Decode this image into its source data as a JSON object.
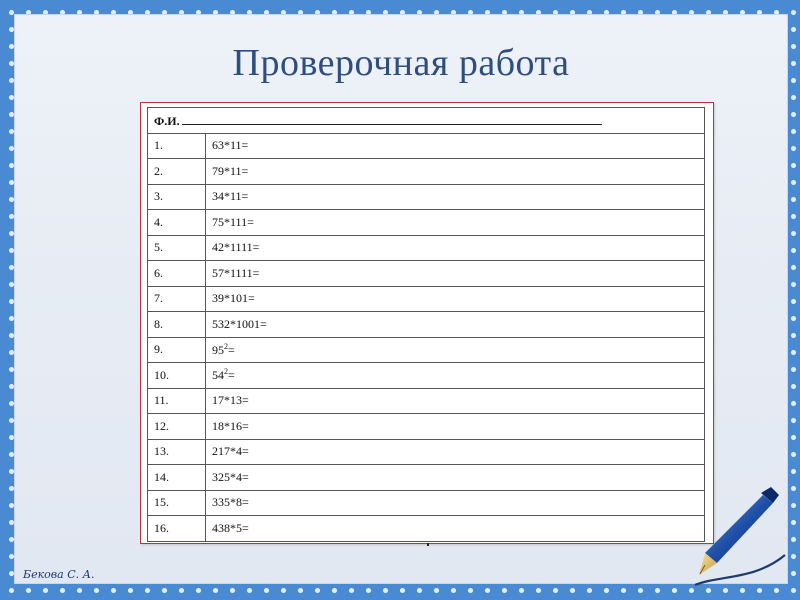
{
  "slide": {
    "title": "Проверочная работа"
  },
  "worksheet": {
    "header_label": "Ф.И.",
    "rows": [
      {
        "num": "1.",
        "task": "63*11="
      },
      {
        "num": "2.",
        "task": "79*11="
      },
      {
        "num": "3.",
        "task": "34*11="
      },
      {
        "num": "4.",
        "task": "75*111="
      },
      {
        "num": "5.",
        "task": "42*1111="
      },
      {
        "num": "6.",
        "task": "57*1111="
      },
      {
        "num": "7.",
        "task": "39*101="
      },
      {
        "num": "8.",
        "task": "532*1001="
      },
      {
        "num": "9.",
        "task": "95",
        "exp": "2",
        "tail": "="
      },
      {
        "num": "10.",
        "task": "54",
        "exp": "2",
        "tail": "="
      },
      {
        "num": "11.",
        "task": "17*13="
      },
      {
        "num": "12.",
        "task": "18*16="
      },
      {
        "num": "13.",
        "task": "217*4="
      },
      {
        "num": "14.",
        "task": "325*4="
      },
      {
        "num": "15.",
        "task": "335*8="
      },
      {
        "num": "16.",
        "task": "438*5="
      }
    ]
  },
  "footer": {
    "author": "Бекова С. А."
  },
  "colors": {
    "frame": "#4a8ad3",
    "title": "#2e4e80",
    "page_border": "#c22e3a"
  }
}
